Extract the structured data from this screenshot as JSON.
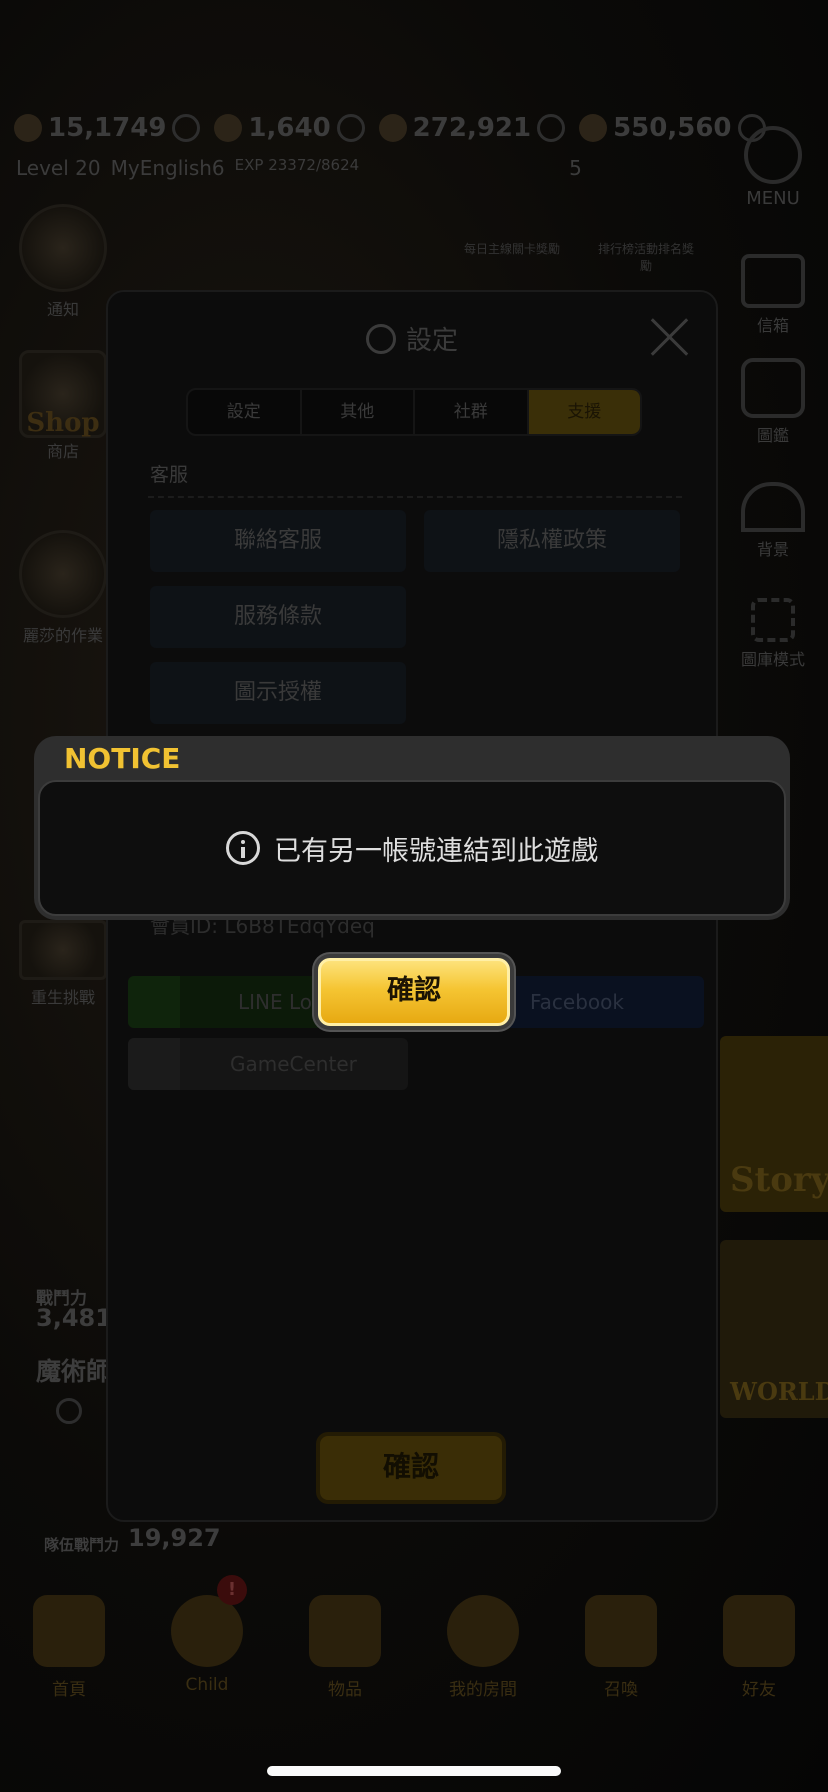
{
  "background": {
    "resources": [
      "15,1749",
      "1,640",
      "272,921",
      "550,560"
    ],
    "player": {
      "level": "Level 20",
      "name": "MyEnglish6",
      "exp": "EXP 23372/8624",
      "hint": "5"
    },
    "left_sidebar": [
      "通知",
      "商店",
      "麗莎的作業",
      "重生挑戰"
    ],
    "shop_logo": "Shop",
    "right_sidebar": [
      "MENU",
      "信箱",
      "圖鑑",
      "背景",
      "圖庫模式"
    ],
    "banners": [
      "每日主線關卡獎勵",
      "排行榜活動排名獎勵"
    ],
    "power_label": "戰鬥力",
    "power_value": "3,481",
    "magic_label": "魔術師",
    "team_power_label": "隊伍戰鬥力",
    "team_power_value": "19,927",
    "story_banner": "Story",
    "world_banner": "WORLD",
    "bottom_nav": [
      "首頁",
      "Child",
      "物品",
      "我的房間",
      "召喚",
      "好友"
    ],
    "child_badge": "!"
  },
  "settings": {
    "title": "設定",
    "tabs": [
      "設定",
      "其他",
      "社群",
      "支援"
    ],
    "active_tab": "支援",
    "section_label": "客服",
    "buttons": [
      "聯絡客服",
      "隱私權政策",
      "服務條款",
      "圖示授權"
    ],
    "id_text": "會員ID: L6B8TEdqYdeq",
    "link_buttons": [
      "LINE Login",
      "Facebook",
      "GameCenter"
    ],
    "confirm_label": "確認"
  },
  "notice": {
    "header": "NOTICE",
    "message": "已有另一帳號連結到此遊戲",
    "confirm_label": "確認"
  },
  "colors": {
    "notice_header": "#f1c232",
    "confirm_button": "#f5c533"
  }
}
